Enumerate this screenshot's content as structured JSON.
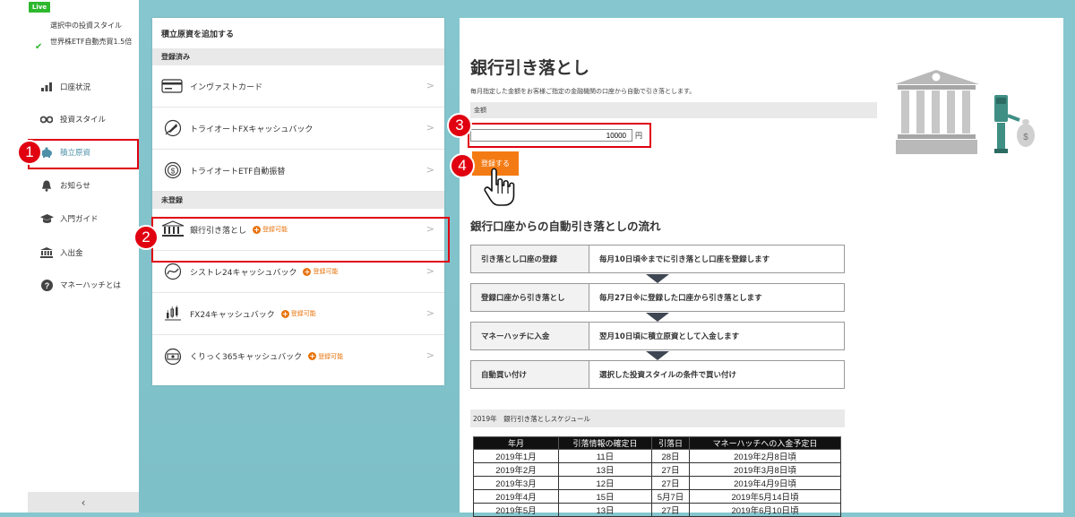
{
  "sidebar": {
    "live_badge": "Live",
    "style_caption": "選択中の投資スタイル",
    "style_value": "世界株ETF自動売買1.5倍",
    "nav": [
      {
        "label": "口座状況",
        "icon": "bar-chart-icon"
      },
      {
        "label": "投資スタイル",
        "icon": "binoculars-icon"
      },
      {
        "label": "積立原資",
        "icon": "piggy-bank-icon"
      },
      {
        "label": "お知らせ",
        "icon": "bell-icon"
      },
      {
        "label": "入門ガイド",
        "icon": "graduation-cap-icon"
      },
      {
        "label": "入出金",
        "icon": "bank-icon"
      },
      {
        "label": "マネーハッチとは",
        "icon": "question-circle-icon"
      }
    ],
    "collapse_icon": "‹"
  },
  "steps": [
    "1",
    "2",
    "3",
    "4"
  ],
  "funding": {
    "title": "積立原資を追加する",
    "registered_header": "登録済み",
    "registered": [
      {
        "name": "インヴァストカード",
        "icon": "credit-card-icon"
      },
      {
        "name": "トライオートFXキャッシュバック",
        "icon": "rocket-coin-icon"
      },
      {
        "name": "トライオートETF自動振替",
        "icon": "dollar-coin-icon"
      }
    ],
    "unregistered_header": "未登録",
    "unregistered": [
      {
        "name": "銀行引き落とし",
        "badge": "登録可能",
        "icon": "bank-icon"
      },
      {
        "name": "シストレ24キャッシュバック",
        "badge": "登録可能",
        "icon": "chart-coin-icon"
      },
      {
        "name": "FX24キャッシュバック",
        "badge": "登録可能",
        "icon": "candlestick-coin-icon"
      },
      {
        "name": "くりっく365キャッシュバック",
        "badge": "登録可能",
        "icon": "cash-coin-icon"
      }
    ]
  },
  "main": {
    "title": "銀行引き落とし",
    "description": "毎月指定した金額をお客様ご指定の金融機関の口座から自動で引き落とします。",
    "amount_label": "金額",
    "amount_value": "10000",
    "amount_unit": "円",
    "register_button": "登録する",
    "flow_title": "銀行口座からの自動引き落としの流れ",
    "flow": [
      {
        "step": "引き落とし口座の登録",
        "desc": "毎月10日頃※までに引き落とし口座を登録します"
      },
      {
        "step": "登録口座から引き落とし",
        "desc": "毎月27日※に登録した口座から引き落とします"
      },
      {
        "step": "マネーハッチに入金",
        "desc": "翌月10日頃に積立原資として入金します"
      },
      {
        "step": "自動買い付け",
        "desc": "選択した投資スタイルの条件で買い付け"
      }
    ],
    "schedule_title": "2019年　銀行引き落としスケジュール",
    "schedule_columns": [
      "年月",
      "引落情報の確定日",
      "引落日",
      "マネーハッチへの入金予定日"
    ],
    "schedule_rows": [
      [
        "2019年1月",
        "11日",
        "28日",
        "2019年2月8日頃"
      ],
      [
        "2019年2月",
        "13日",
        "27日",
        "2019年3月8日頃"
      ],
      [
        "2019年3月",
        "12日",
        "27日",
        "2019年4月9日頃"
      ],
      [
        "2019年4月",
        "15日",
        "5月7日",
        "2019年5月14日頃"
      ],
      [
        "2019年5月",
        "13日",
        "27日",
        "2019年6月10日頃"
      ]
    ]
  },
  "colors": {
    "background": "#86c6ce",
    "highlight": "#e00010",
    "accent_orange": "#f47b14",
    "active_nav": "#4d90a8",
    "check_green": "#2eb82e"
  }
}
